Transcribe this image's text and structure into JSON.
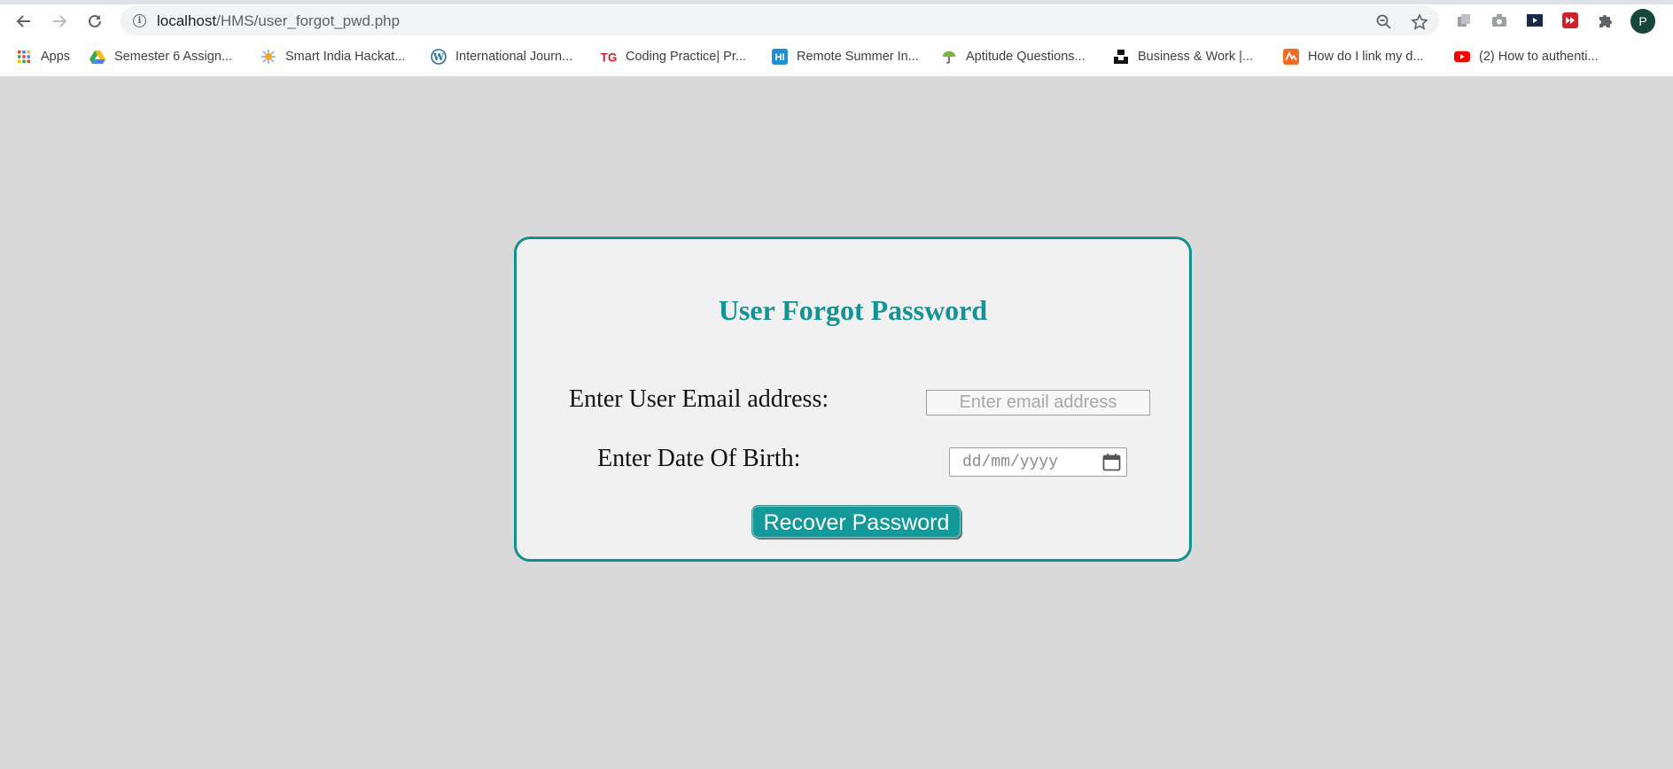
{
  "browser": {
    "url_host": "localhost",
    "url_path": "/HMS/user_forgot_pwd.php",
    "profile_initial": "P",
    "bookmarks": [
      {
        "label": "Apps",
        "icon": "apps-grid-icon"
      },
      {
        "label": "Semester 6 Assign...",
        "icon": "google-drive-icon"
      },
      {
        "label": "Smart India Hackat...",
        "icon": "sih-logo-icon"
      },
      {
        "label": "International Journ...",
        "icon": "wordpress-icon"
      },
      {
        "label": "Coding Practice| Pr...",
        "icon": "tg-logo-icon"
      },
      {
        "label": "Remote Summer In...",
        "icon": "hi-logo-icon"
      },
      {
        "label": "Aptitude Questions...",
        "icon": "umbrella-icon"
      },
      {
        "label": "Business & Work |...",
        "icon": "unsplash-icon"
      },
      {
        "label": "How do I link my d...",
        "icon": "n-logo-icon"
      },
      {
        "label": "(2) How to authenti...",
        "icon": "youtube-icon"
      }
    ]
  },
  "form": {
    "title": "User Forgot Password",
    "email_label": "Enter User Email address:",
    "email_placeholder": "Enter email address",
    "dob_label": "Enter Date Of Birth:",
    "dob_placeholder": "dd/mm/yyyy",
    "submit_label": "Recover Password"
  },
  "colors": {
    "accent": "#148f91",
    "page_background": "#d9d9d9",
    "card_background": "#f1f1f1"
  }
}
